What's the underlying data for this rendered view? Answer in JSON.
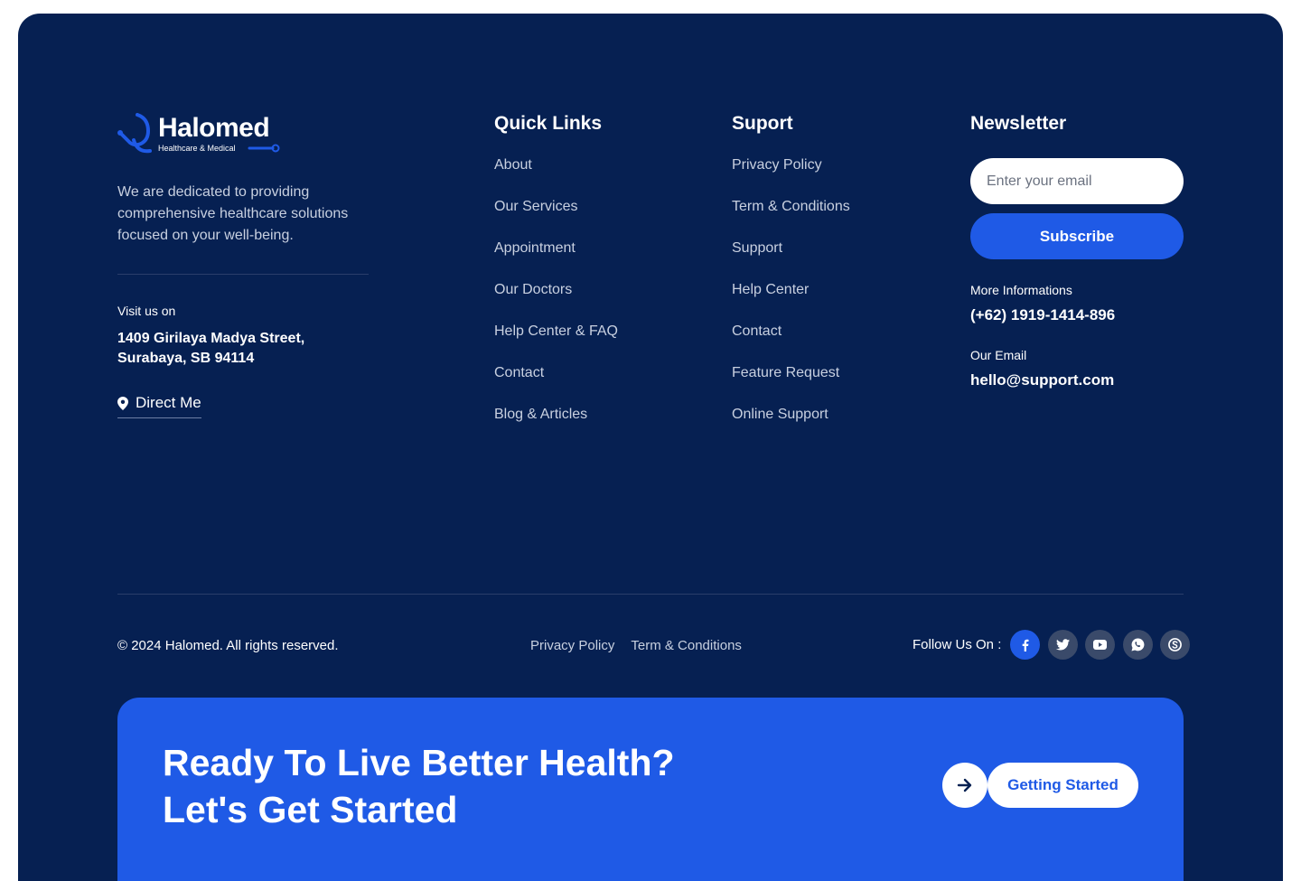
{
  "brand": {
    "name": "Halomed",
    "tagline": "Healthcare & Medical",
    "description": "We are dedicated to providing comprehensive healthcare solutions focused on your well-being.",
    "visit_label": "Visit us on",
    "address_line1": "1409 Girilaya Madya Street,",
    "address_line2": "Surabaya, SB 94114",
    "direct_label": "Direct Me"
  },
  "quick_links": {
    "title": "Quick Links",
    "items": [
      "About",
      "Our Services",
      "Appointment",
      "Our Doctors",
      "Help Center & FAQ",
      "Contact",
      "Blog & Articles"
    ]
  },
  "support": {
    "title": "Suport",
    "items": [
      "Privacy Policy",
      "Term & Conditions",
      "Support",
      "Help Center",
      "Contact",
      "Feature Request",
      "Online Support"
    ]
  },
  "newsletter": {
    "title": "Newsletter",
    "email_placeholder": "Enter your email",
    "email_value": "",
    "subscribe_label": "Subscribe",
    "info_label": "More Informations",
    "phone": "(+62) 1919-1414-896",
    "email_label": "Our Email",
    "email": "hello@support.com"
  },
  "bottom": {
    "copyright": "© 2024 Halomed. All rights reserved.",
    "legal": [
      "Privacy Policy",
      "Term & Conditions"
    ],
    "follow_label": "Follow Us On :",
    "socials": [
      "facebook-icon",
      "twitter-icon",
      "youtube-icon",
      "whatsapp-icon",
      "skype-icon"
    ]
  },
  "cta": {
    "line1": "Ready To Live Better Health?",
    "line2": "Let's Get Started",
    "button_label": "Getting Started"
  },
  "colors": {
    "background": "#062052",
    "accent": "#1f5ae6",
    "text_muted": "#c8d0e0"
  }
}
